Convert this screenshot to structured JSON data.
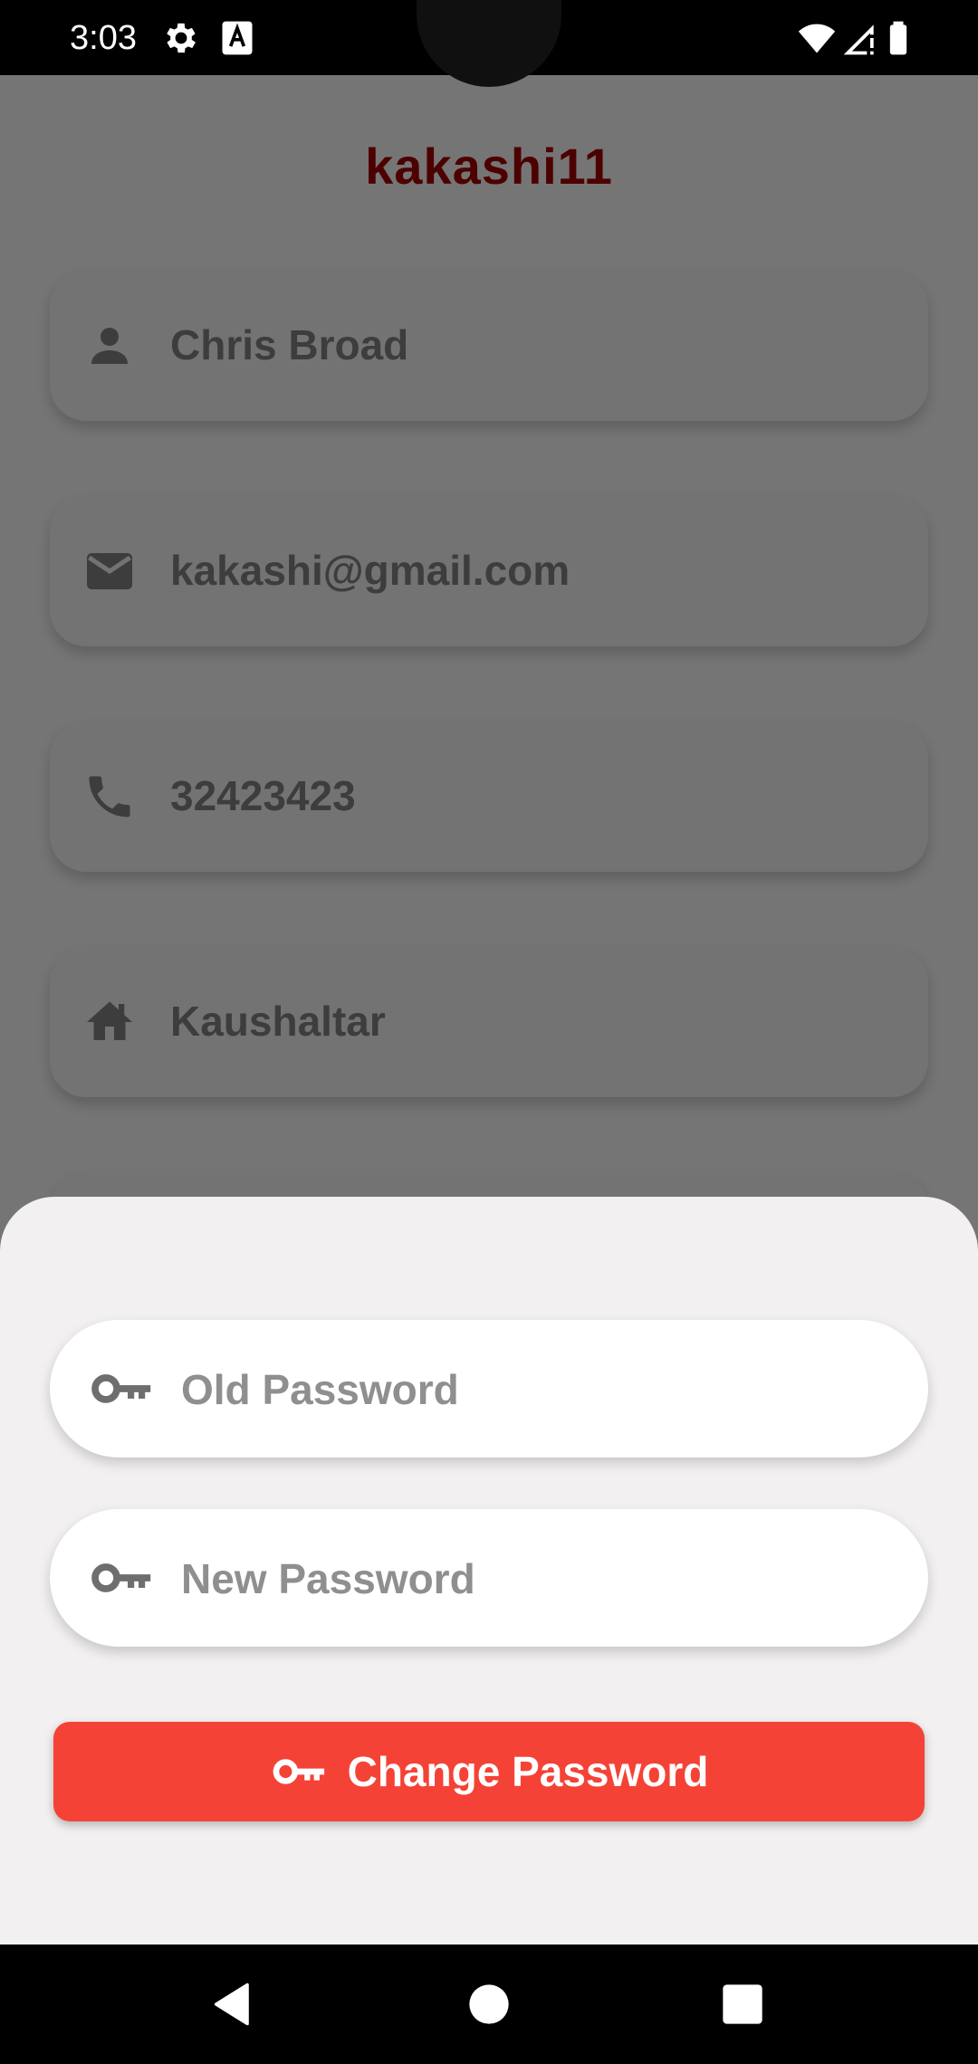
{
  "status_bar": {
    "time": "3:03",
    "icons": [
      "gear-icon",
      "text-a-icon",
      "wifi-icon",
      "signal-icon",
      "battery-icon"
    ]
  },
  "profile": {
    "username": "kakashi11",
    "fields": [
      {
        "icon": "person-icon",
        "value": "Chris Broad"
      },
      {
        "icon": "email-icon",
        "value": "kakashi@gmail.com"
      },
      {
        "icon": "phone-icon",
        "value": "32423423"
      },
      {
        "icon": "home-icon",
        "value": "Kaushaltar"
      }
    ]
  },
  "change_password_sheet": {
    "old_password": {
      "value": "",
      "placeholder": "Old Password",
      "icon": "key-icon"
    },
    "new_password": {
      "value": "",
      "placeholder": "New Password",
      "icon": "key-icon"
    },
    "submit_label": "Change Password"
  },
  "nav_bar": {
    "buttons": [
      "back-icon",
      "home-circle-icon",
      "recents-square-icon"
    ]
  },
  "colors": {
    "scrim_background": "#757575",
    "sheet_background": "#f2f0f1",
    "accent_red": "#f44336",
    "username_color": "#4d0000"
  }
}
